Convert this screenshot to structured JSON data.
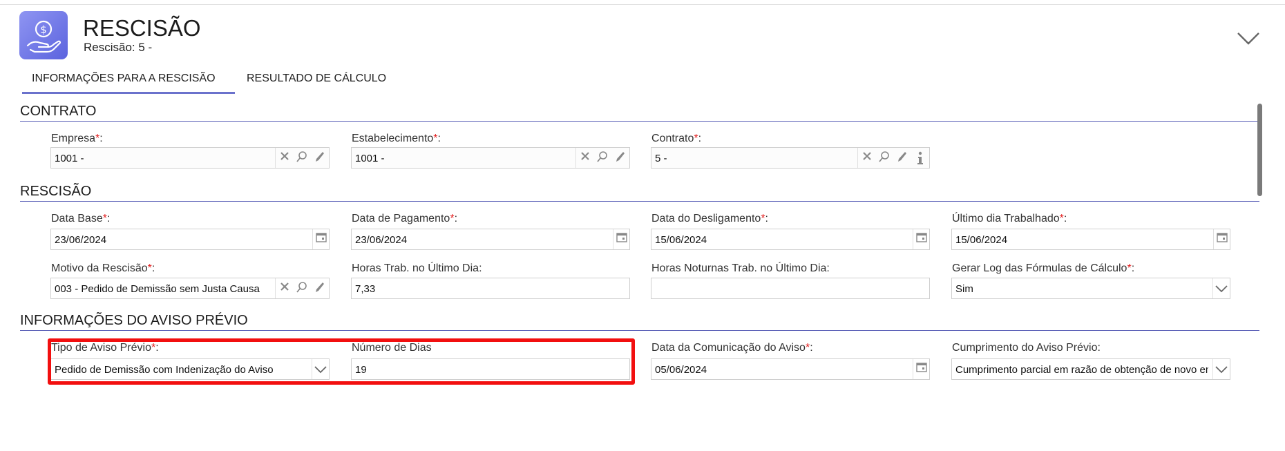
{
  "header": {
    "title": "RESCISÃO",
    "subtitle": "Rescisão: 5 - ",
    "app_icon": "money-hand-icon",
    "collapse_icon": "chevron-down-icon"
  },
  "tabs": [
    {
      "label": "INFORMAÇÕES PARA A RESCISÃO",
      "active": true
    },
    {
      "label": "RESULTADO DE CÁLCULO",
      "active": false
    }
  ],
  "sections": {
    "contrato": "CONTRATO",
    "rescisao": "RESCISÃO",
    "aviso": "INFORMAÇÕES DO AVISO PRÉVIO"
  },
  "contrato": {
    "empresa": {
      "label": "Empresa",
      "value": "1001 - "
    },
    "estabelecimento": {
      "label": "Estabelecimento",
      "value": "1001 - "
    },
    "contrato": {
      "label": "Contrato",
      "value": "5 - "
    }
  },
  "rescisao": {
    "data_base": {
      "label": "Data Base",
      "value": "23/06/2024"
    },
    "data_pagamento": {
      "label": "Data de Pagamento",
      "value": "23/06/2024"
    },
    "data_desligamento": {
      "label": "Data do Desligamento",
      "value": "15/06/2024"
    },
    "ultimo_dia": {
      "label": "Último dia Trabalhado",
      "value": "15/06/2024"
    },
    "motivo": {
      "label": "Motivo da Rescisão",
      "value": "003 - Pedido de Demissão sem Justa Causa"
    },
    "horas_ultimo_dia": {
      "label": "Horas Trab. no Último Dia:",
      "value": "7,33"
    },
    "horas_noturnas": {
      "label": "Horas Noturnas Trab. no Último Dia:",
      "value": ""
    },
    "gerar_log": {
      "label": "Gerar Log das Fórmulas de Cálculo",
      "value": "Sim"
    }
  },
  "aviso": {
    "tipo": {
      "label": "Tipo de Aviso Prévio",
      "value": "Pedido de Demissão com Indenização do Aviso"
    },
    "numero_dias": {
      "label": "Número de Dias",
      "value": "19"
    },
    "data_comunicacao": {
      "label": "Data da Comunicação do Aviso",
      "value": "05/06/2024"
    },
    "cumprimento": {
      "label": "Cumprimento do Aviso Prévio:",
      "value": "Cumprimento parcial em razão de obtenção de novo emprego"
    }
  },
  "colors": {
    "accent": "#5a5fb7",
    "required": "#e21b1b",
    "highlight": "#f20f0f",
    "icon_bg": "#6d74e6"
  }
}
